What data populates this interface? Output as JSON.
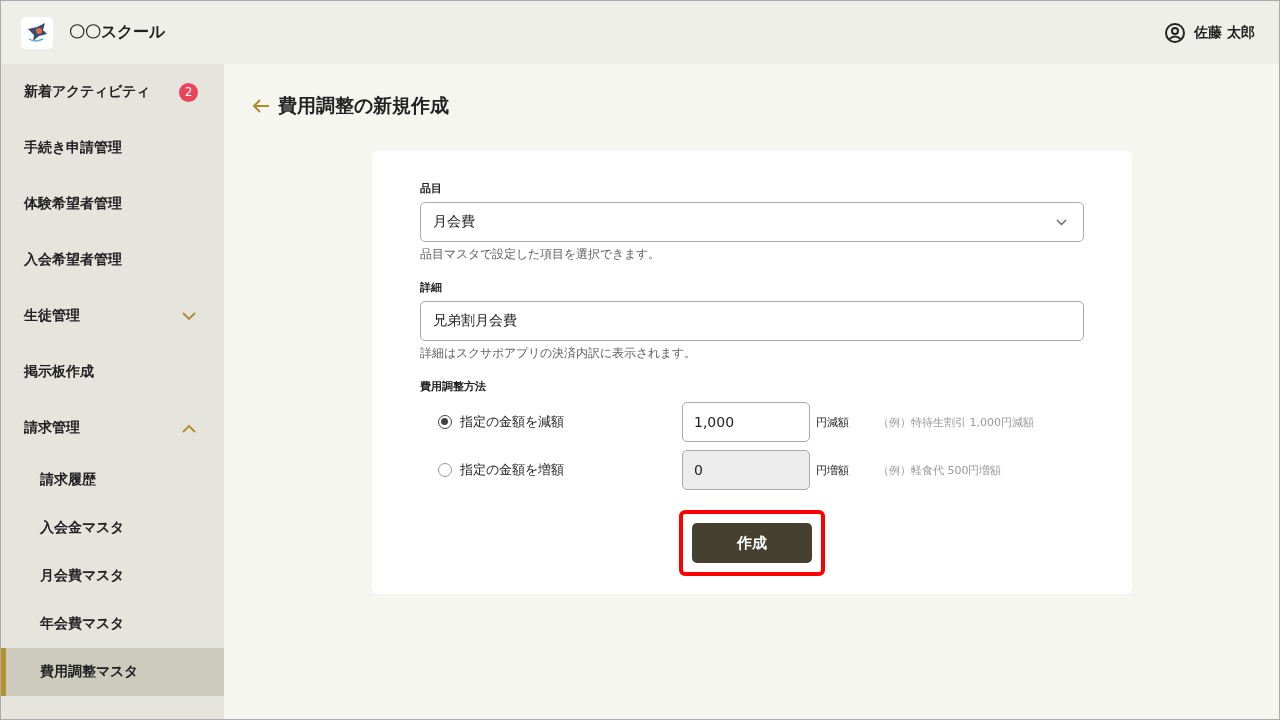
{
  "header": {
    "school_name": "〇〇スクール",
    "user_name": "佐藤 太郎"
  },
  "sidebar": {
    "items": [
      {
        "label": "新着アクティビティ",
        "badge": "2",
        "selected": false
      },
      {
        "label": "手続き申請管理",
        "selected": false
      },
      {
        "label": "体験希望者管理",
        "selected": false
      },
      {
        "label": "入会希望者管理",
        "selected": false
      },
      {
        "label": "生徒管理",
        "selected": false,
        "expanded": false
      },
      {
        "label": "掲示板作成",
        "selected": false
      },
      {
        "label": "請求管理",
        "selected": false,
        "expanded": true,
        "children": [
          {
            "label": "請求履歴",
            "selected": false
          },
          {
            "label": "入会金マスタ",
            "selected": false
          },
          {
            "label": "月会費マスタ",
            "selected": false
          },
          {
            "label": "年会費マスタ",
            "selected": false
          },
          {
            "label": "費用調整マスタ",
            "selected": true
          }
        ]
      }
    ]
  },
  "page": {
    "title": "費用調整の新規作成"
  },
  "form": {
    "item": {
      "label": "品目",
      "value": "月会費",
      "hint": "品目マスタで設定した項目を選択できます。"
    },
    "detail": {
      "label": "詳細",
      "value": "兄弟割月会費",
      "hint": "詳細はスクサポアプリの決済内訳に表示されます。"
    },
    "method": {
      "label": "費用調整方法",
      "options": [
        {
          "label": "指定の金額を減額",
          "selected": true,
          "amount": "1,000",
          "disabled": false,
          "unit": "円減額",
          "example": "（例）特待生割引  1,000円減額"
        },
        {
          "label": "指定の金額を増額",
          "selected": false,
          "amount": "0",
          "disabled": true,
          "unit": "円増額",
          "example": "（例）軽食代  500円増額"
        }
      ]
    },
    "submit": {
      "label": "作成",
      "highlighted": true
    }
  }
}
